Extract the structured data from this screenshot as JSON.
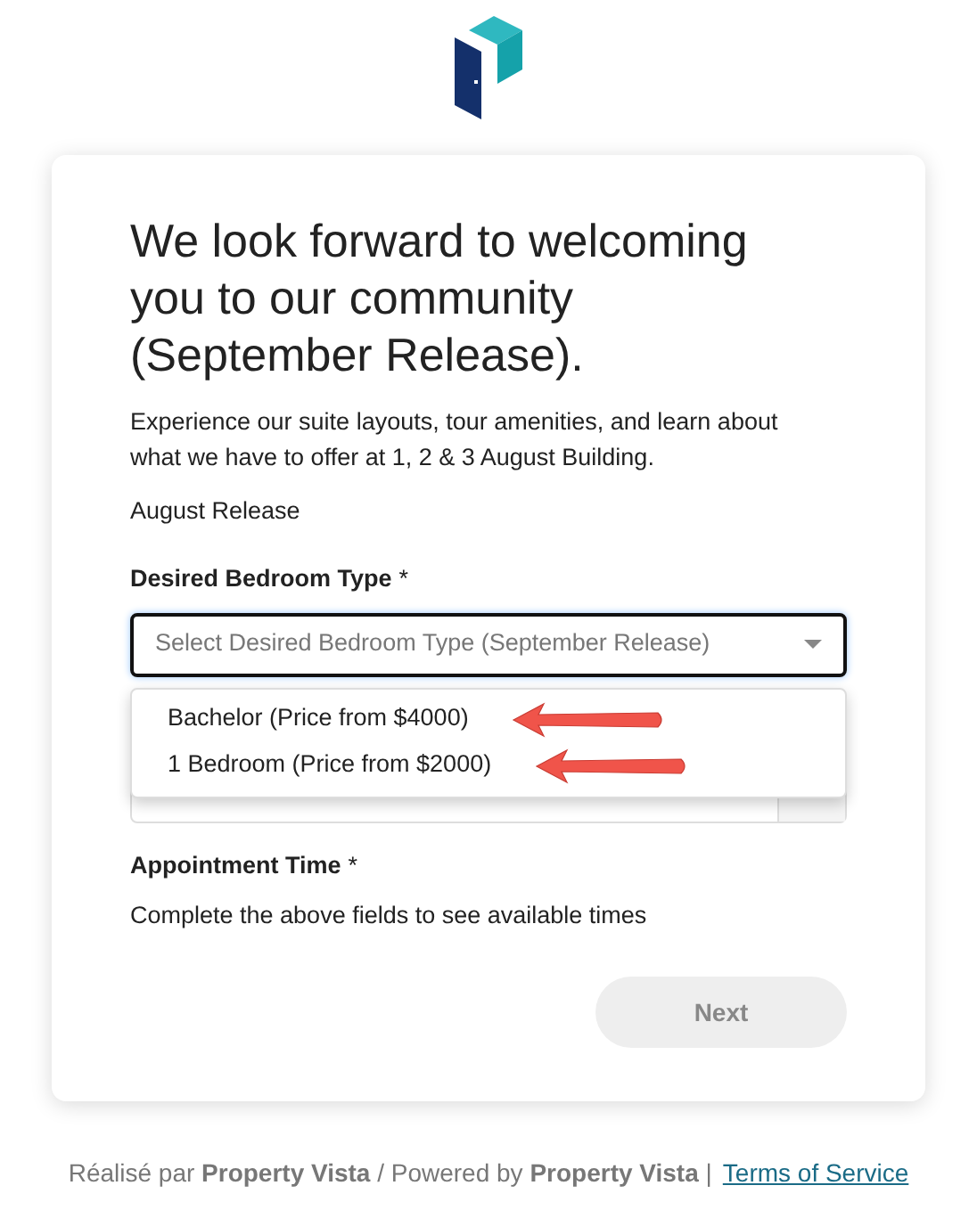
{
  "heading": "We look forward to welcoming you to our community (September Release).",
  "intro": "Experience our suite layouts, tour amenities, and learn about what we have to offer at 1, 2 & 3 August Building.",
  "release": "August Release",
  "bedroom_field": {
    "label": "Desired Bedroom Type",
    "required_mark": "*",
    "placeholder": "Select Desired Bedroom Type (September Release)",
    "expanded": true,
    "options": [
      {
        "label": "Bachelor (Price from $4000)",
        "selected": false,
        "annotated": true
      },
      {
        "label": "1 Bedroom (Price from $2000)",
        "selected": false,
        "annotated": true
      }
    ]
  },
  "appointment": {
    "label": "Appointment Time",
    "required_mark": "*",
    "hint": "Complete the above fields to see available times"
  },
  "next_button": {
    "label": "Next",
    "disabled": true
  },
  "footer": {
    "credit": "Réalisé par **Property Vista** / Powered by **Property Vista** |",
    "link": "Terms of Service"
  }
}
